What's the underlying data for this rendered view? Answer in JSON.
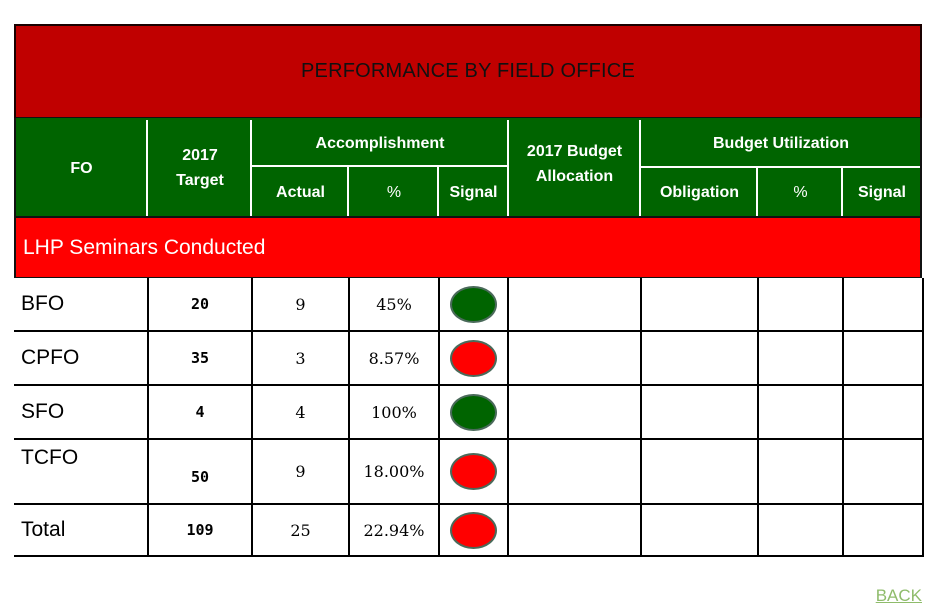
{
  "title": "PERFORMANCE BY FIELD OFFICE",
  "colors": {
    "title_bg": "#c00000",
    "header_bg": "#006400",
    "section_bg": "#ff0000",
    "signal_green": "#006400",
    "signal_red": "#ff0000",
    "link": "#8fbc6b"
  },
  "header": {
    "fo": "FO",
    "target_line1": "2017",
    "target_line2": "Target",
    "accomplishment": "Accomplishment",
    "actual": "Actual",
    "acc_pct": "%",
    "acc_signal": "Signal",
    "budget_line1": "2017 Budget",
    "budget_line2": "Allocation",
    "budget_utilization": "Budget Utilization",
    "obligation": "Obligation",
    "bu_pct": "%",
    "bu_signal": "Signal"
  },
  "section": "LHP Seminars Conducted",
  "rows": [
    {
      "fo": "BFO",
      "target": "20",
      "actual": "9",
      "pct": "45%",
      "signal": "green",
      "budget": "",
      "obligation": "",
      "bu_pct": "",
      "bu_signal": ""
    },
    {
      "fo": "CPFO",
      "target": "35",
      "actual": "3",
      "pct": "8.57%",
      "signal": "red",
      "budget": "",
      "obligation": "",
      "bu_pct": "",
      "bu_signal": ""
    },
    {
      "fo": "SFO",
      "target": "4",
      "actual": "4",
      "pct": "100%",
      "signal": "green",
      "budget": "",
      "obligation": "",
      "bu_pct": "",
      "bu_signal": ""
    },
    {
      "fo": "TCFO",
      "target": "50",
      "actual": "9",
      "pct": "18.00%",
      "signal": "red",
      "budget": "",
      "obligation": "",
      "bu_pct": "",
      "bu_signal": ""
    },
    {
      "fo": "Total",
      "target": "109",
      "actual": "25",
      "pct": "22.94%",
      "signal": "red",
      "budget": "",
      "obligation": "",
      "bu_pct": "",
      "bu_signal": ""
    }
  ],
  "back_link": "BACK"
}
